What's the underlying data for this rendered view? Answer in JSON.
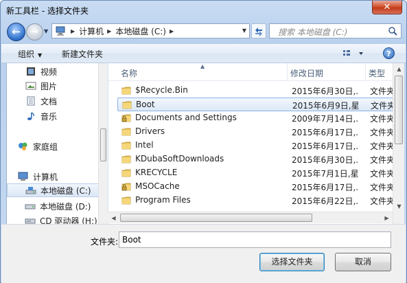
{
  "window": {
    "title": "新工具栏 - 选择文件夹",
    "close_glyph": "✕"
  },
  "address": {
    "back_glyph": "←",
    "forward_glyph": "→",
    "crumbs": [
      "计算机",
      "本地磁盘 (C:)"
    ],
    "search_placeholder": "搜索 本地磁盘 (C:)"
  },
  "toolbar": {
    "organize_label": "组织",
    "new_folder_label": "新建文件夹",
    "help_glyph": "?"
  },
  "nav": {
    "items": [
      {
        "label": "视频",
        "icon": "video-library-icon"
      },
      {
        "label": "图片",
        "icon": "pictures-library-icon"
      },
      {
        "label": "文档",
        "icon": "documents-library-icon"
      },
      {
        "label": "音乐",
        "icon": "music-library-icon"
      },
      {
        "label": "家庭组",
        "icon": "homegroup-icon"
      },
      {
        "label": "计算机",
        "icon": "computer-icon"
      },
      {
        "label": "本地磁盘 (C:)",
        "icon": "local-disk-icon",
        "selected": true
      },
      {
        "label": "本地磁盘 (D:)",
        "icon": "local-disk-icon"
      },
      {
        "label": "CD 驱动器 (H:)",
        "icon": "cd-drive-icon"
      }
    ]
  },
  "columns": {
    "name": "名称",
    "date": "修改日期",
    "type": "类型"
  },
  "files": [
    {
      "name": "$Recycle.Bin",
      "date": "2015年6月30日,...",
      "type": "文件夹",
      "locked": false
    },
    {
      "name": "Boot",
      "date": "2015年6月9日,星...",
      "type": "文件夹",
      "locked": false,
      "selected": true
    },
    {
      "name": "Documents and Settings",
      "date": "2009年7月14日,...",
      "type": "文件夹",
      "locked": true
    },
    {
      "name": "Drivers",
      "date": "2015年6月17日,...",
      "type": "文件夹",
      "locked": false
    },
    {
      "name": "Intel",
      "date": "2015年6月17日,...",
      "type": "文件夹",
      "locked": false
    },
    {
      "name": "KDubaSoftDownloads",
      "date": "2015年6月30日,...",
      "type": "文件夹",
      "locked": false
    },
    {
      "name": "KRECYCLE",
      "date": "2015年7月1日,星...",
      "type": "文件夹",
      "locked": false
    },
    {
      "name": "MSOCache",
      "date": "2015年6月17日,...",
      "type": "文件夹",
      "locked": true
    },
    {
      "name": "Program Files",
      "date": "2015年6月22日,...",
      "type": "文件夹",
      "locked": false
    }
  ],
  "bottom": {
    "folder_label": "文件夹:",
    "folder_value": "Boot",
    "select_label": "选择文件夹",
    "cancel_label": "取消"
  },
  "colors": {
    "selection_border": "#8db2e3",
    "folder_yellow": "#e8c35a",
    "title_bar": "#c9dcf3"
  }
}
